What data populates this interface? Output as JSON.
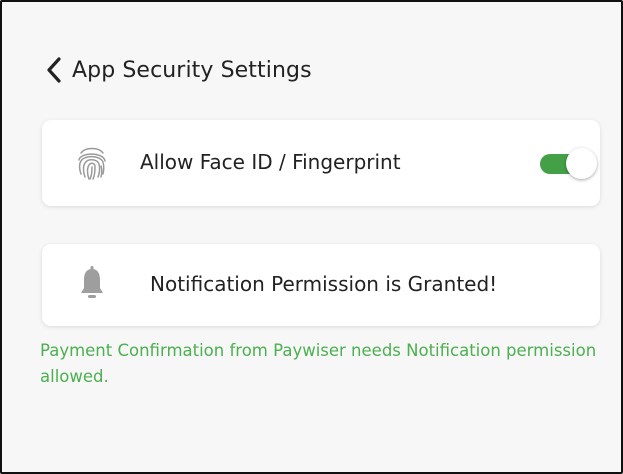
{
  "header": {
    "title": "App Security Settings",
    "back_icon": "chevron-left-icon"
  },
  "biometric": {
    "label": "Allow Face ID / Fingerprint",
    "icon": "fingerprint-icon",
    "toggle_on": true,
    "toggle_color": "#43a047"
  },
  "notification": {
    "label": "Notification Permission is Granted!",
    "icon": "bell-icon"
  },
  "note": {
    "text": "Payment Confirmation from Paywiser needs Notification permission allowed.",
    "color": "#4caf50"
  }
}
